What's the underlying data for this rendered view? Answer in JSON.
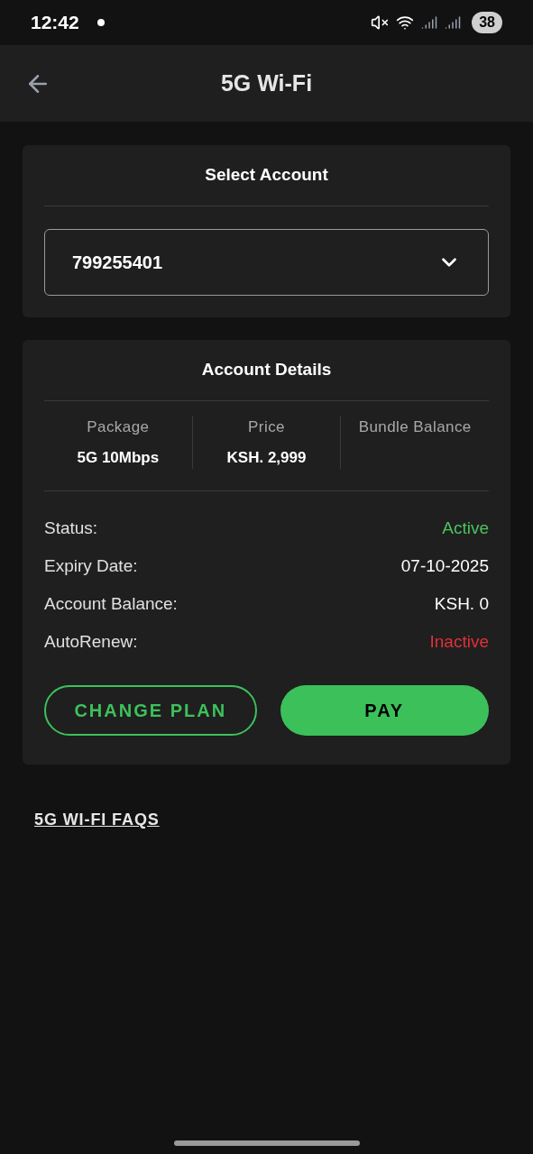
{
  "status_bar": {
    "time": "12:42",
    "battery": "38"
  },
  "app_bar": {
    "title": "5G Wi-Fi"
  },
  "select_account": {
    "title": "Select Account",
    "value": "799255401"
  },
  "account_details": {
    "title": "Account Details",
    "summary": [
      {
        "label": "Package",
        "value": "5G 10Mbps"
      },
      {
        "label": "Price",
        "value": "KSH. 2,999"
      },
      {
        "label": "Bundle Balance"
      }
    ],
    "rows": [
      {
        "label": "Status:",
        "value": "Active",
        "color": "#4cc35e"
      },
      {
        "label": "Expiry Date:",
        "value": "07-10-2025",
        "color": "#ffffff"
      },
      {
        "label": "Account Balance:",
        "value": "KSH. 0",
        "color": "#ffffff"
      },
      {
        "label": "AutoRenew:",
        "value": "Inactive",
        "color": "#e0303a"
      }
    ],
    "buttons": [
      {
        "label": "CHANGE PLAN",
        "kind": "outline"
      },
      {
        "label": "PAY",
        "kind": "filled"
      }
    ]
  },
  "faq_link": "5G WI-FI FAQS"
}
